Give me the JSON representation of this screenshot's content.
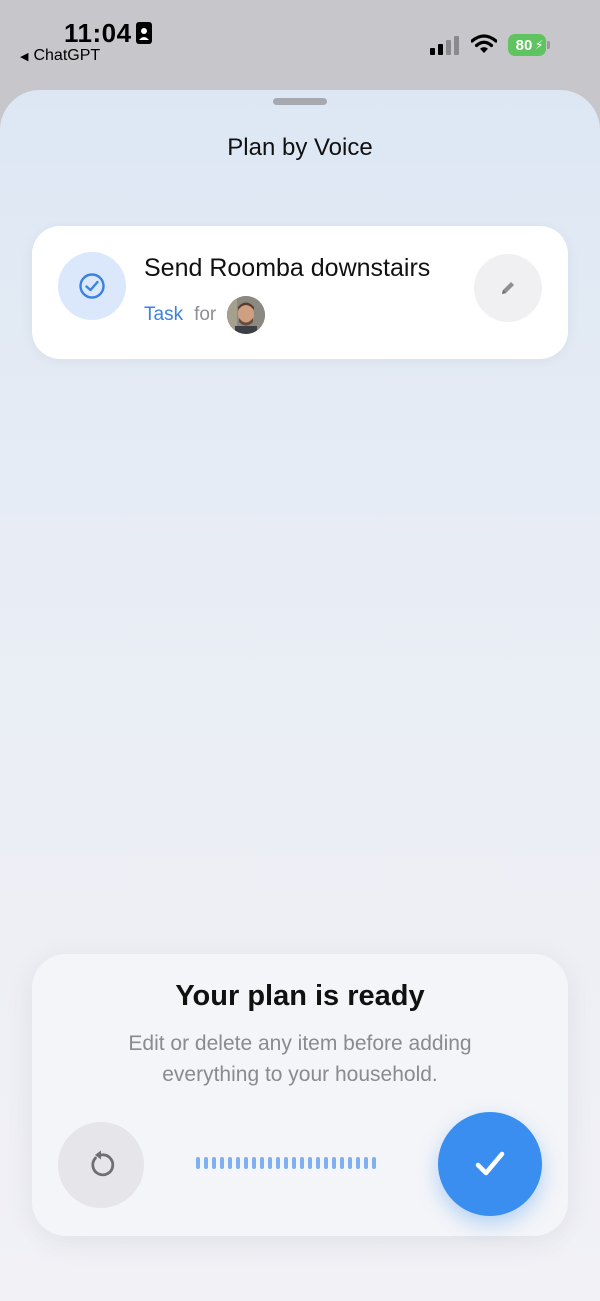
{
  "status_bar": {
    "time": "11:04",
    "back_app": "ChatGPT",
    "battery": "80"
  },
  "sheet": {
    "title": "Plan by Voice"
  },
  "task": {
    "title": "Send Roomba downstairs",
    "type": "Task",
    "for_label": "for",
    "check_icon": "check-circle-icon",
    "edit_icon": "pencil-icon"
  },
  "plan": {
    "title": "Your plan is ready",
    "subtitle": "Edit or delete any item before adding everything to your household.",
    "restart_icon": "restart-icon",
    "confirm_icon": "checkmark-icon"
  },
  "colors": {
    "accent": "#3a8ef0",
    "task_type": "#3a82df",
    "battery": "#5fc45f"
  }
}
